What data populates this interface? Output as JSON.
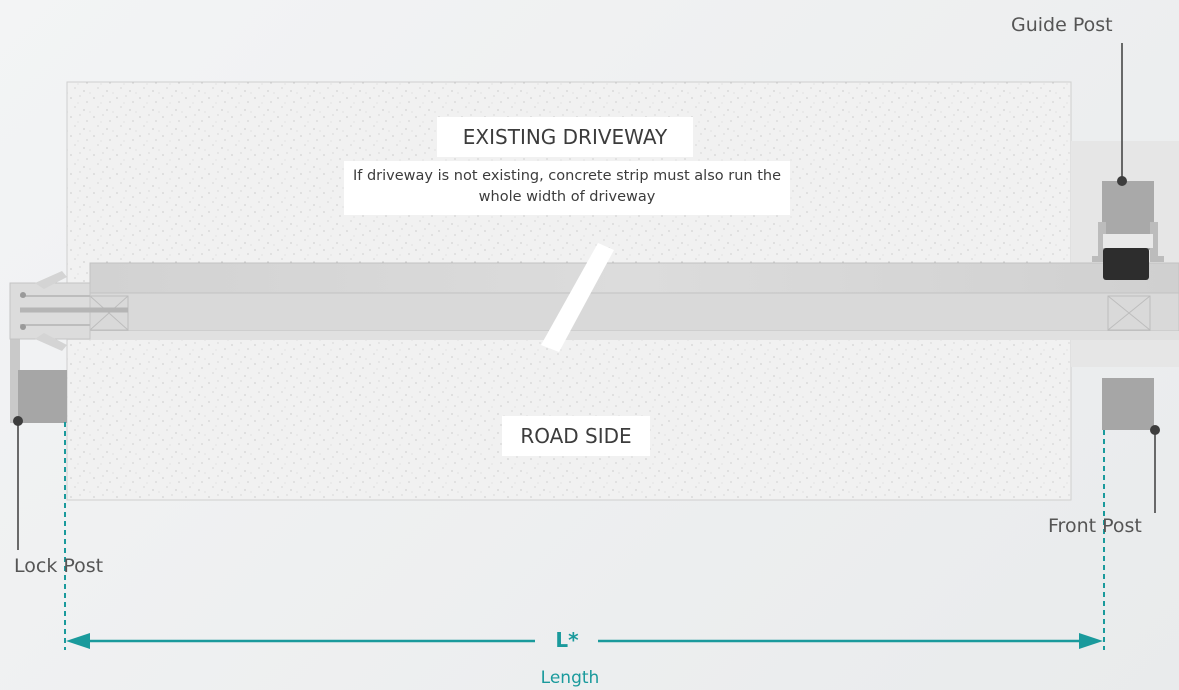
{
  "labels": {
    "driveway_title": "EXISTING DRIVEWAY",
    "driveway_note": "If driveway is not existing, concrete strip must also run the whole width of driveway",
    "road_side": "ROAD SIDE",
    "guide_post": "Guide Post",
    "front_post": "Front Post",
    "lock_post": "Lock Post"
  },
  "dimension": {
    "symbol": "L*",
    "caption": "Length"
  },
  "colors": {
    "accent": "#1a9a9c",
    "concrete": "#efefef",
    "rail": "#d6d6d6",
    "post": "#a6a6a6",
    "post_dark": "#2d2d2d",
    "leader": "#3d3d3d"
  }
}
